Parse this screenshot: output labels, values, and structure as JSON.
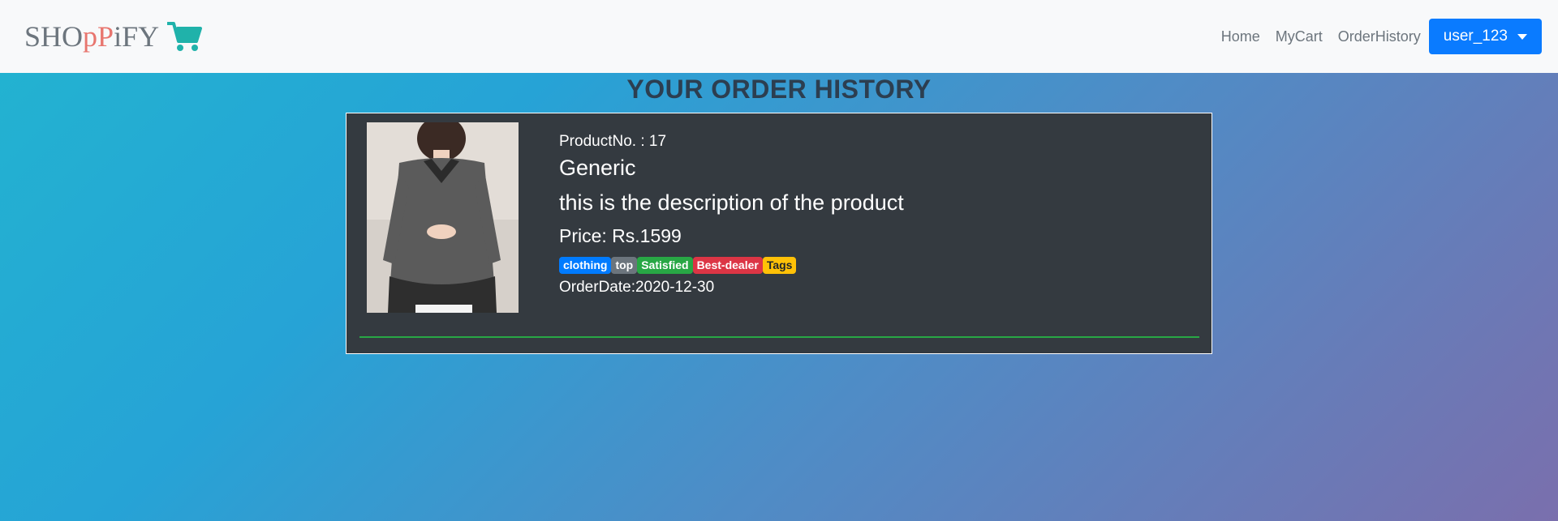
{
  "brand": {
    "part1": "SHO",
    "part2": "pP",
    "part3": "iFY",
    "cart_icon": "shopping-cart-icon",
    "accent_color": "#e8766f",
    "cart_color": "#20b2aa"
  },
  "nav": {
    "home": "Home",
    "mycart": "MyCart",
    "orderhistory": "OrderHistory",
    "user": "user_123"
  },
  "page": {
    "title": "YOUR ORDER HISTORY"
  },
  "orders": [
    {
      "product_no": "ProductNo. : 17",
      "name": "Generic",
      "description": "this is the description of the product",
      "price": "Price: Rs.1599",
      "tags": [
        {
          "label": "clothing",
          "color": "#007bff"
        },
        {
          "label": "top",
          "color": "#6c757d"
        },
        {
          "label": "Satisfied",
          "color": "#28a745"
        },
        {
          "label": "Best-dealer",
          "color": "#dc3545"
        },
        {
          "label": "Tags",
          "color": "#ffc107"
        }
      ],
      "order_date": "OrderDate:2020-12-30"
    }
  ]
}
